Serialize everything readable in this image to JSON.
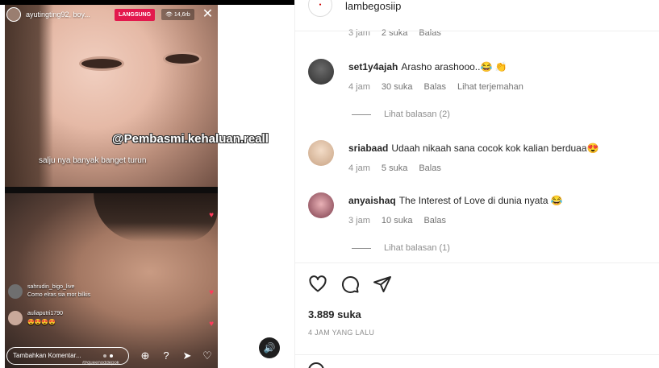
{
  "live": {
    "username": "ayutingting92, boy...",
    "live_badge": "LANGSUNG",
    "viewers": "14,6rb",
    "overlay_handle": "@Pembasmi.kehaluan.reall",
    "caption": "salju nya banyak banget turun",
    "comments": [
      {
        "name": "sahrudin_bigo_live",
        "text": "Como elras sia mor bilkis"
      },
      {
        "name": "auliaputri1790",
        "text": "😍😍😍😍"
      }
    ],
    "comment_placeholder": "Tambahkan Komentar...",
    "watermark": "@queenoddepok"
  },
  "post": {
    "account": "lambegosiip",
    "top_meta": {
      "time": "3 jam",
      "likes": "2 suka",
      "reply": "Balas"
    },
    "comments": [
      {
        "user": "set1y4ajah",
        "text": "Arasho arashooo..😂 👏",
        "time": "4 jam",
        "likes": "30 suka",
        "reply": "Balas",
        "translate": "Lihat terjemahan",
        "replies": "Lihat balasan (2)"
      },
      {
        "user": "sriabaad",
        "text": "Udaah nikaah sana cocok kok kalian berduaa😍",
        "time": "4 jam",
        "likes": "5 suka",
        "reply": "Balas"
      },
      {
        "user": "anyaishaq",
        "text": "The Interest of Love di dunia nyata 😂",
        "time": "3 jam",
        "likes": "10 suka",
        "reply": "Balas",
        "replies": "Lihat balasan (1)"
      }
    ],
    "like_count": "3.889 suka",
    "posted_ago": "4 JAM YANG LALU"
  }
}
